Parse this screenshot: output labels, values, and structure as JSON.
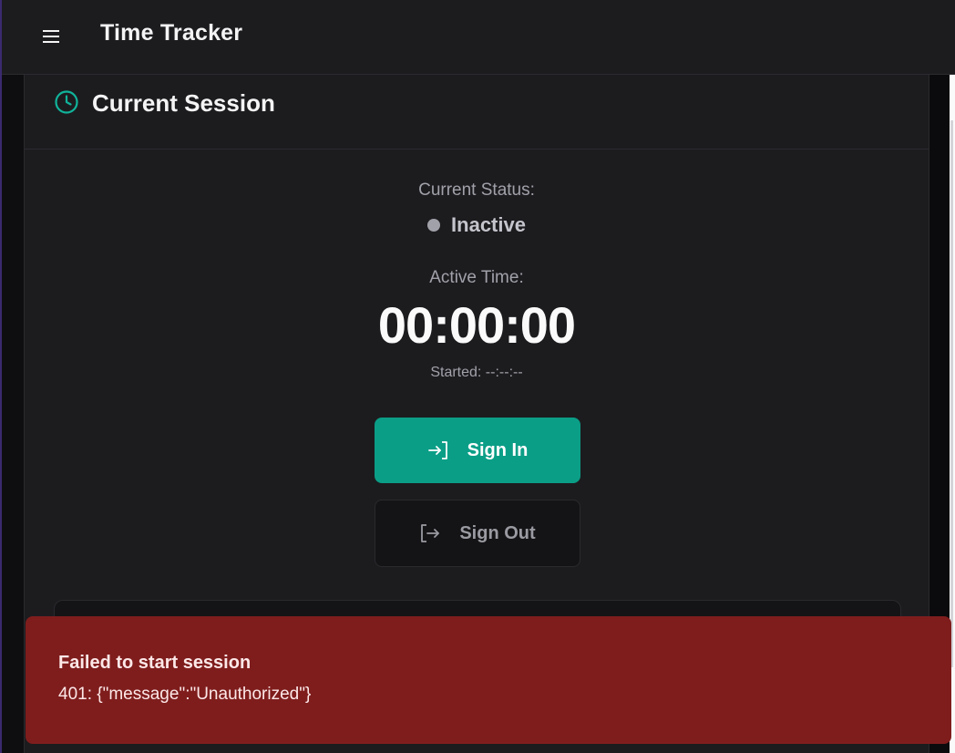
{
  "header": {
    "title": "Time Tracker",
    "menu_icon": "hamburger-menu-icon"
  },
  "session": {
    "title": "Current Session",
    "title_icon": "clock-icon",
    "status_label": "Current Status:",
    "status_value": "Inactive",
    "active_label": "Active Time:",
    "timer": "00:00:00",
    "started": "Started: --:--:--"
  },
  "actions": {
    "sign_in_label": "Sign In",
    "sign_in_icon": "log-in-icon",
    "sign_out_label": "Sign Out",
    "sign_out_icon": "log-out-icon"
  },
  "toast": {
    "title": "Failed to start session",
    "message": "401: {\"message\":\"Unauthorized\"}"
  },
  "colors": {
    "accent": "#0b9e87",
    "error_bg": "#7f1d1d",
    "card_bg": "#1c1c1f"
  }
}
